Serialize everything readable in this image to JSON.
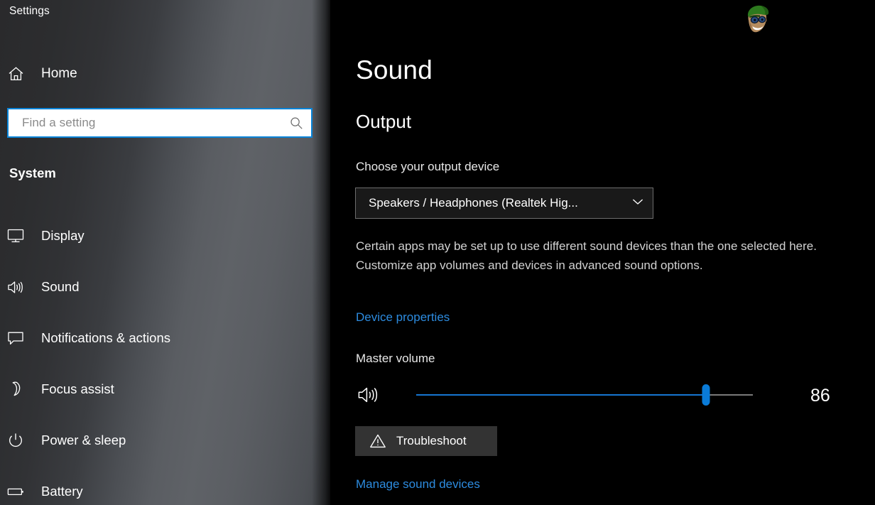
{
  "window": {
    "title": "Settings"
  },
  "sidebar": {
    "home": {
      "label": "Home",
      "icon": "home-icon"
    },
    "search": {
      "placeholder": "Find a setting",
      "value": "",
      "icon": "search-icon",
      "focus_border_color": "#0a84d8"
    },
    "group_title": "System",
    "items": [
      {
        "label": "Display",
        "icon": "monitor-icon"
      },
      {
        "label": "Sound",
        "icon": "speaker-icon"
      },
      {
        "label": "Notifications & actions",
        "icon": "notification-bubble-icon"
      },
      {
        "label": "Focus assist",
        "icon": "moon-icon"
      },
      {
        "label": "Power & sleep",
        "icon": "power-icon"
      },
      {
        "label": "Battery",
        "icon": "battery-icon"
      }
    ]
  },
  "content": {
    "page_title": "Sound",
    "section_title": "Output",
    "output_device": {
      "label": "Choose your output device",
      "selected": "Speakers / Headphones (Realtek Hig...",
      "chevron": "chevron-down-icon"
    },
    "description": "Certain apps may be set up to use different sound devices than the one selected here. Customize app volumes and devices in advanced sound options.",
    "device_properties_link": "Device properties",
    "master_volume": {
      "label": "Master volume",
      "value": 86,
      "min": 0,
      "max": 100,
      "icon": "speaker-icon",
      "fill_color": "#1675d1",
      "thumb_color": "#0a7bd8",
      "track_color": "#7a7a7a"
    },
    "troubleshoot_button": {
      "label": "Troubleshoot",
      "icon": "warning-triangle-icon"
    },
    "manage_sound_devices_link": "Manage sound devices"
  },
  "watermark": {
    "name": "appuals-avatar-watermark",
    "hat_color": "#2d7a1e",
    "skin_color": "#b38a5e"
  },
  "theme": {
    "content_background": "#000000",
    "link_color": "#2d8ce0",
    "accent": "#0a7bd8"
  }
}
